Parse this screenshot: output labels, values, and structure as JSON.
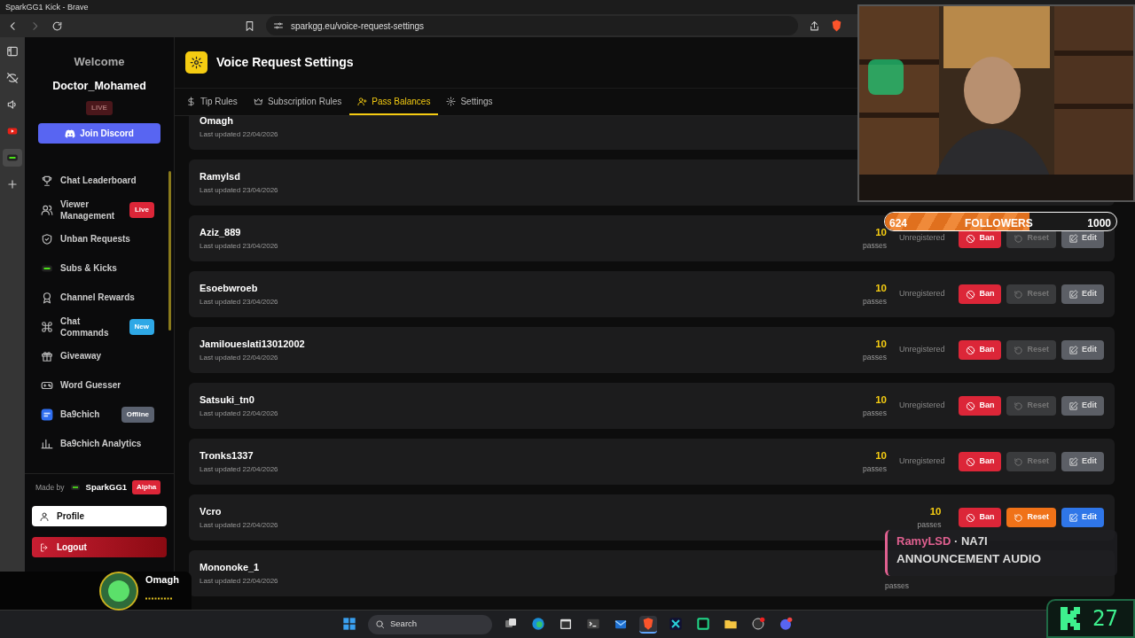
{
  "window": {
    "title": "SparkGG1 Kick - Brave"
  },
  "browser": {
    "url": "sparkgg.eu/voice-request-settings",
    "sidebar_icons": [
      {
        "kind": "panel",
        "selected": false
      },
      {
        "kind": "eye-off",
        "selected": false
      },
      {
        "kind": "speaker",
        "selected": false
      },
      {
        "kind": "video",
        "selected": false
      },
      {
        "kind": "stream",
        "selected": true
      },
      {
        "kind": "plus",
        "selected": false
      }
    ]
  },
  "app_sidebar": {
    "welcome": "Welcome",
    "username": "Doctor_Mohamed",
    "live_badge": "LIVE",
    "discord_button": "Join Discord",
    "items": [
      {
        "label": "Chat Leaderboard",
        "kind": "trophy"
      },
      {
        "label": "Viewer Management",
        "kind": "users",
        "badge": {
          "text": "Live",
          "color": "#dc2638"
        }
      },
      {
        "label": "Unban Requests",
        "kind": "shield"
      },
      {
        "label": "Subs & Kicks",
        "kind": "stream"
      },
      {
        "label": "Channel Rewards",
        "kind": "medal"
      },
      {
        "label": "Chat Commands",
        "kind": "cmd",
        "badge": {
          "text": "New",
          "color": "#2ea8e6"
        }
      },
      {
        "label": "Giveaway",
        "kind": "gift"
      },
      {
        "label": "Word Guesser",
        "kind": "gamepad"
      },
      {
        "label": "Ba9chich",
        "kind": "app",
        "badge": {
          "text": "Offline",
          "color": "#5b6270"
        }
      },
      {
        "label": "Ba9chich Analytics",
        "kind": "chart"
      }
    ],
    "made_by": "Made by",
    "brand": "SparkGG1",
    "brand_badge": "Alpha",
    "profile_button": "Profile",
    "logout_button": "Logout"
  },
  "page": {
    "title": "Voice Request Settings",
    "tabs": [
      {
        "label": "Tip Rules",
        "kind": "dollar",
        "selected": false
      },
      {
        "label": "Subscription Rules",
        "kind": "crown",
        "selected": false
      },
      {
        "label": "Pass Balances",
        "kind": "user-plus",
        "selected": true
      },
      {
        "label": "Settings",
        "kind": "gear",
        "selected": false
      }
    ]
  },
  "balances": [
    {
      "name": "Omagh",
      "updated": "Last updated 22/04/2026"
    },
    {
      "name": "Ramylsd",
      "updated": "Last updated 23/04/2026"
    },
    {
      "name": "Aziz_889",
      "updated": "Last updated 23/04/2026",
      "passes": "10",
      "unit": "passes",
      "status": "Unregistered",
      "ban": "Ban",
      "reset": "Reset",
      "edit": "Edit",
      "actions_active": false
    },
    {
      "name": "Esoebwroeb",
      "updated": "Last updated 23/04/2026",
      "passes": "10",
      "unit": "passes",
      "status": "Unregistered",
      "ban": "Ban",
      "reset": "Reset",
      "edit": "Edit",
      "actions_active": false
    },
    {
      "name": "Jamiloueslati13012002",
      "updated": "Last updated 22/04/2026",
      "passes": "10",
      "unit": "passes",
      "status": "Unregistered",
      "ban": "Ban",
      "reset": "Reset",
      "edit": "Edit",
      "actions_active": false
    },
    {
      "name": "Satsuki_tn0",
      "updated": "Last updated 22/04/2026",
      "passes": "10",
      "unit": "passes",
      "status": "Unregistered",
      "ban": "Ban",
      "reset": "Reset",
      "edit": "Edit",
      "actions_active": false
    },
    {
      "name": "Tronks1337",
      "updated": "Last updated 22/04/2026",
      "passes": "10",
      "unit": "passes",
      "status": "Unregistered",
      "ban": "Ban",
      "reset": "Reset",
      "edit": "Edit",
      "actions_active": false
    },
    {
      "name": "Vcro",
      "updated": "Last updated 22/04/2026",
      "passes": "10",
      "unit": "passes",
      "ban": "Ban",
      "reset": "Reset",
      "edit": "Edit",
      "actions_active": true
    },
    {
      "name": "Mononoke_1",
      "updated": "Last updated 22/04/2026",
      "unit": "passes"
    }
  ],
  "overlays": {
    "followers": {
      "current": "624",
      "label": "FOLLOWERS",
      "goal": "1000",
      "level": 0.624
    },
    "alert": {
      "user": "RamyLSD",
      "message": "· NA7I",
      "line2": "ANNOUNCEMENT AUDIO"
    },
    "viewer": {
      "name": "Omagh"
    },
    "counter": {
      "value": "27"
    }
  },
  "taskbar": {
    "search": "Search",
    "apps": [
      {
        "kind": "windows",
        "selected": false
      },
      {
        "kind": "taskview",
        "selected": false
      },
      {
        "kind": "edge",
        "selected": false
      },
      {
        "kind": "calendar",
        "selected": false
      },
      {
        "kind": "terminal",
        "selected": false
      },
      {
        "kind": "mail",
        "selected": false
      },
      {
        "kind": "brave",
        "selected": true
      },
      {
        "kind": "teal",
        "selected": false
      },
      {
        "kind": "ide",
        "selected": false
      },
      {
        "kind": "folder",
        "selected": false
      },
      {
        "kind": "obs",
        "selected": false
      },
      {
        "kind": "chat",
        "selected": false
      }
    ]
  }
}
